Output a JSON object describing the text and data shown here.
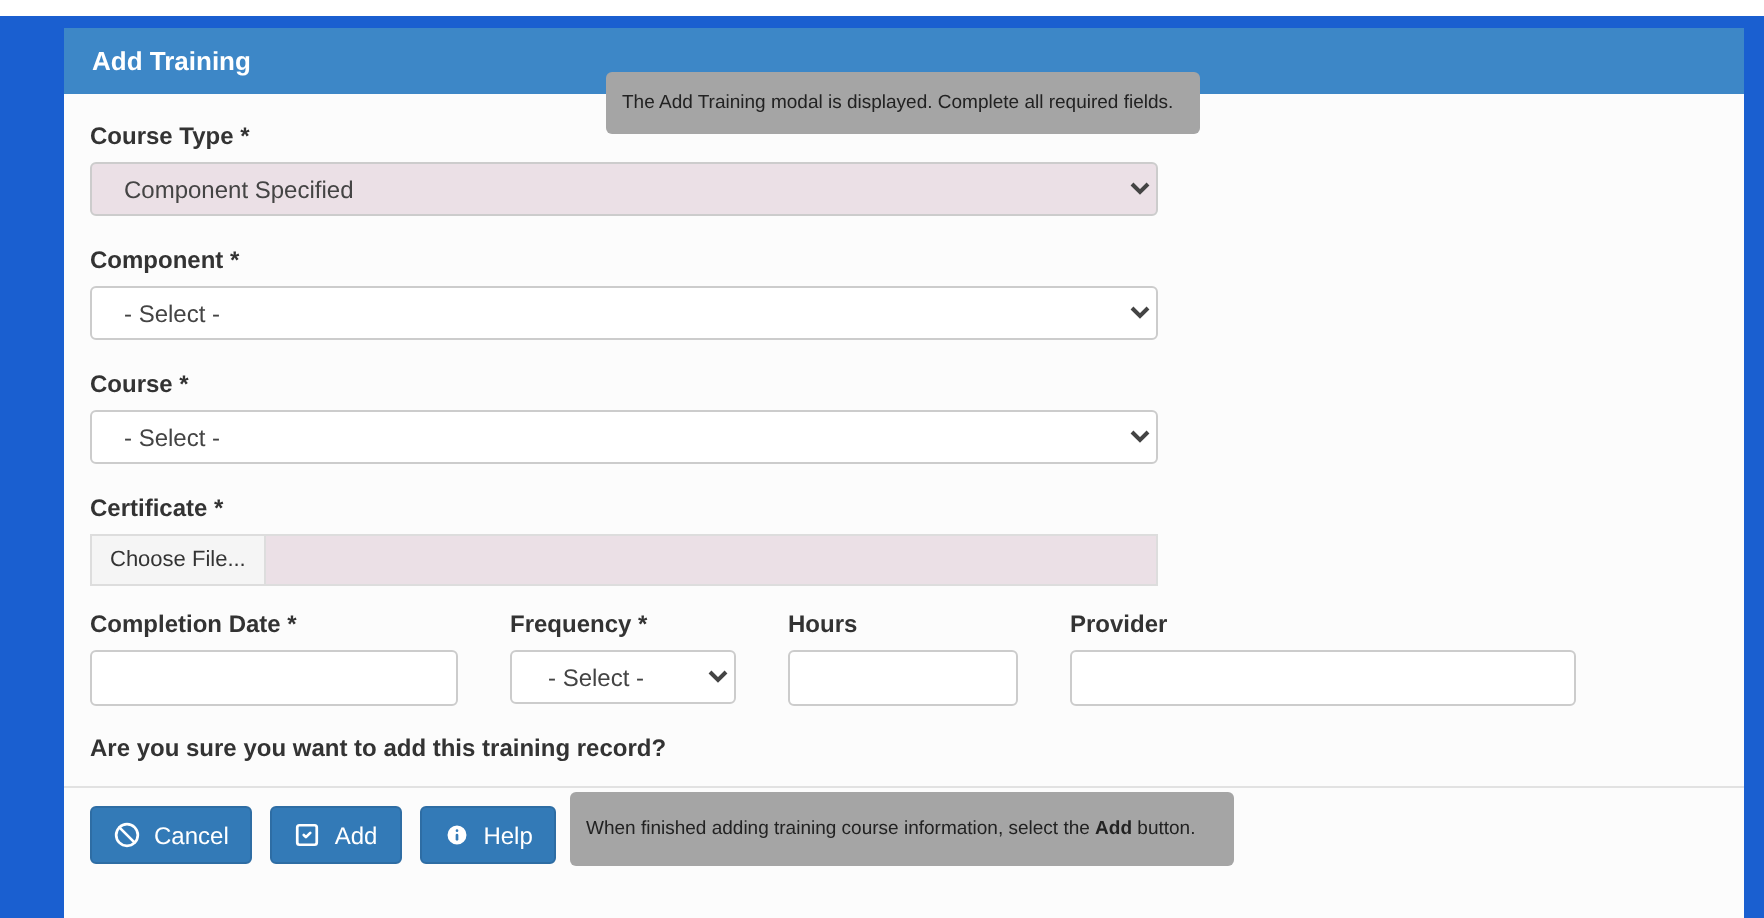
{
  "modal": {
    "title": "Add Training"
  },
  "fields": [
    {
      "kind": "select",
      "label": "Course Type *",
      "value": "Component Specified",
      "highlighted": true
    },
    {
      "kind": "select",
      "label": "Component *",
      "value": "- Select -",
      "highlighted": false
    },
    {
      "kind": "select",
      "label": "Course *",
      "value": "- Select -",
      "highlighted": false
    },
    {
      "kind": "file",
      "label": "Certificate *",
      "button": "Choose File...",
      "highlighted": true
    }
  ],
  "row_fields": [
    {
      "kind": "input",
      "label": "Completion Date *"
    },
    {
      "kind": "select",
      "label": "Frequency *",
      "value": "- Select -"
    },
    {
      "kind": "input",
      "label": "Hours"
    },
    {
      "kind": "input",
      "label": "Provider"
    }
  ],
  "question": "Are you sure you want to add this training record?",
  "buttons": [
    {
      "kind": "cancel",
      "label": "Cancel"
    },
    {
      "kind": "add",
      "label": "Add"
    },
    {
      "kind": "help",
      "label": "Help"
    }
  ],
  "callouts": [
    {
      "text": "The Add Training modal is displayed. Complete all required fields."
    },
    {
      "text": "When finished adding training course information, select the **Add** button."
    }
  ]
}
